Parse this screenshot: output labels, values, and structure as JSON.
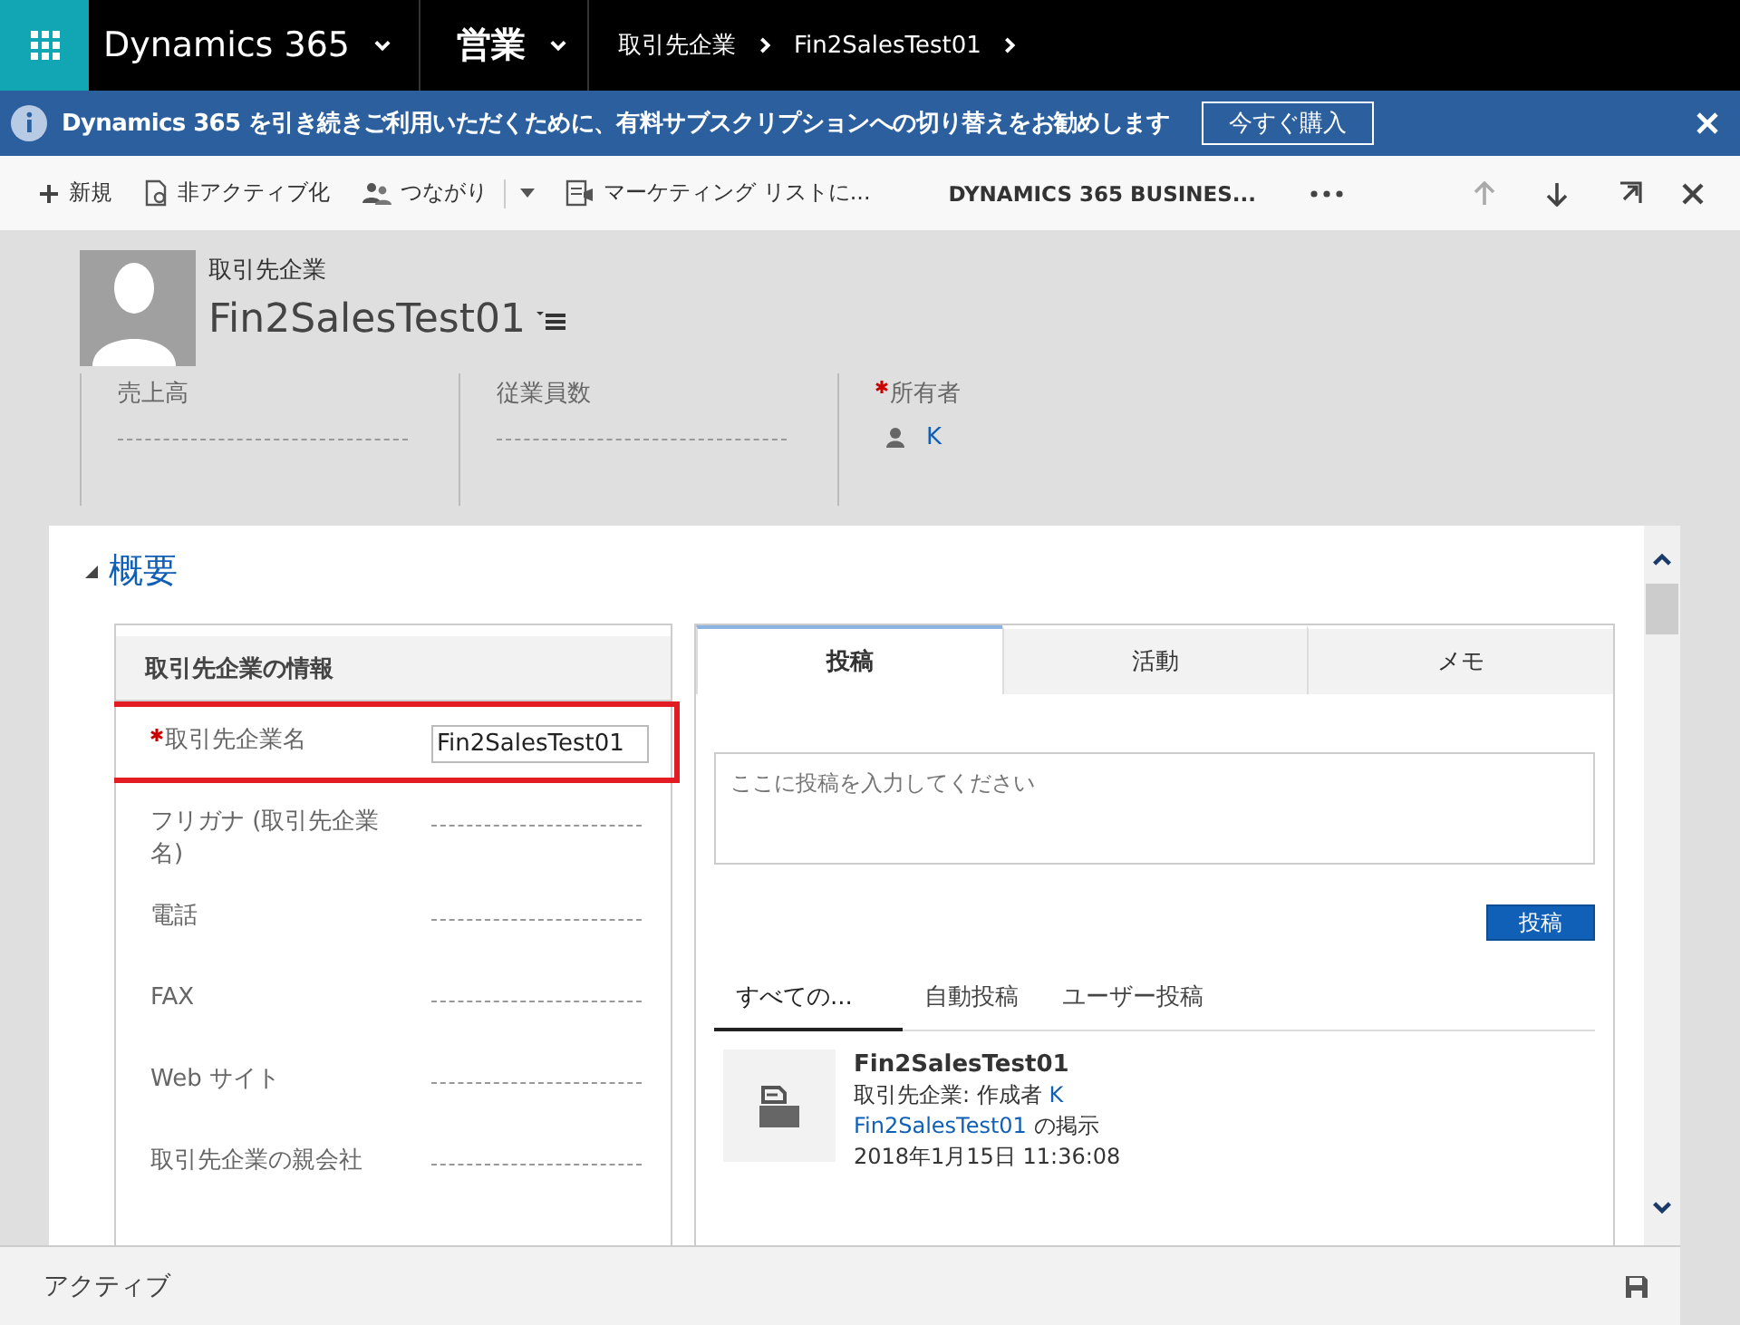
{
  "app_bar": {
    "app_name": "Dynamics 365",
    "area": "営業",
    "breadcrumbs": [
      "取引先企業",
      "Fin2SalesTest01"
    ]
  },
  "banner": {
    "message": "Dynamics 365 を引き続きご利用いただくために、有料サブスクリプションへの切り替えをお勧めします",
    "button": "今すぐ購入"
  },
  "command_bar": {
    "commands": [
      {
        "label": "新規",
        "kind": "new"
      },
      {
        "label": "非アクティブ化",
        "kind": "deactivate"
      },
      {
        "label": "つながり",
        "kind": "connect"
      },
      {
        "label": "マーケティング リストに...",
        "kind": "marketing"
      },
      {
        "label": "DYNAMICS 365 BUSINES...",
        "kind": "plain"
      }
    ]
  },
  "header": {
    "entity_type": "取引先企業",
    "record_name": "Fin2SalesTest01",
    "fields": [
      {
        "label": "売上高",
        "required": false,
        "kind": "empty"
      },
      {
        "label": "従業員数",
        "required": false,
        "kind": "empty"
      },
      {
        "label": "所有者",
        "required": true,
        "kind": "lookup",
        "value": "K"
      }
    ]
  },
  "section": {
    "title": "概要",
    "expanded": true
  },
  "form": {
    "title": "取引先企業の情報",
    "fields": [
      {
        "label": "取引先企業名",
        "required": true,
        "highlighted": true,
        "value": "Fin2SalesTest01"
      },
      {
        "label": "フリガナ (取引先企業名)",
        "required": false,
        "highlighted": false
      },
      {
        "label": "電話",
        "required": false,
        "highlighted": false
      },
      {
        "label": "FAX",
        "required": false,
        "highlighted": false
      },
      {
        "label": "Web サイト",
        "required": false,
        "highlighted": false
      },
      {
        "label": "取引先企業の親会社",
        "required": false,
        "highlighted": false
      }
    ]
  },
  "social": {
    "tabs": [
      {
        "label": "投稿",
        "selected": true
      },
      {
        "label": "活動",
        "selected": false
      },
      {
        "label": "メモ",
        "selected": false
      }
    ],
    "post_placeholder": "ここに投稿を入力してください",
    "post_button": "投稿",
    "filters": [
      {
        "label": "すべての...",
        "selected": true
      },
      {
        "label": "自動投稿",
        "selected": false
      },
      {
        "label": "ユーザー投稿",
        "selected": false
      }
    ],
    "posts": [
      {
        "title": "Fin2SalesTest01",
        "byline": "取引先企業: 作成者",
        "author": "K",
        "link": "Fin2SalesTest01",
        "link_suffix": "の掲示",
        "timestamp": "2018年1月15日 11:36:08"
      }
    ]
  },
  "status_bar": {
    "status": "アクティブ"
  }
}
